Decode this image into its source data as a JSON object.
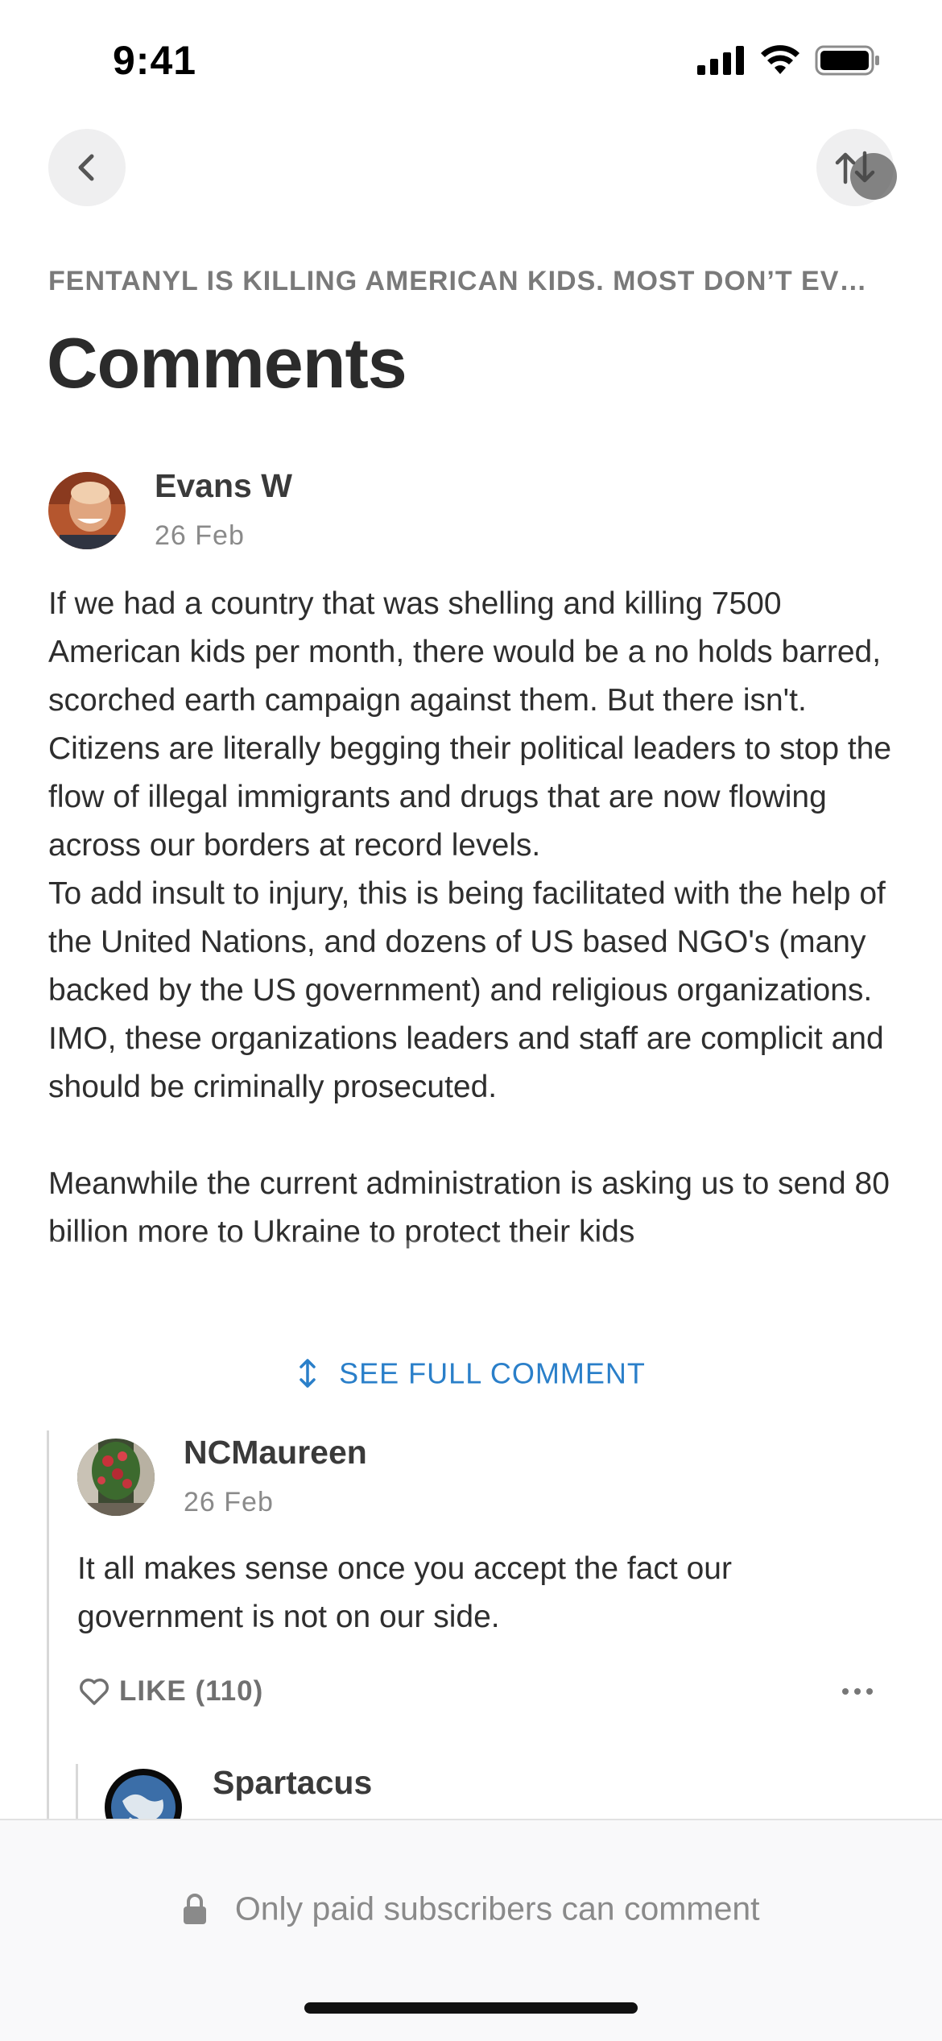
{
  "status_bar": {
    "time": "9:41"
  },
  "header": {
    "article_title": "FENTANYL IS KILLING AMERICAN KIDS. MOST DON’T EV…",
    "page_title": "Comments"
  },
  "comments": [
    {
      "author": "Evans W",
      "date": "26  Feb",
      "paragraphs": [
        "If we had a country that was shelling and killing 7500 American kids per month, there would be a no holds barred, scorched earth campaign against them.  But there isn't.",
        "Citizens are literally begging their political leaders to stop the flow of illegal immigrants and drugs that are now flowing across our borders at record levels.",
        "To add insult to injury, this is being facilitated with the help of the United Nations, and dozens of US based NGO's (many backed by the US government) and religious organizations.  IMO, these organizations leaders and staff are complicit and should be criminally prosecuted.",
        "",
        "Meanwhile the current administration is asking us to send 80 billion more to Ukraine to protect their kids"
      ],
      "see_full_label": "SEE FULL COMMENT"
    },
    {
      "author": "NCMaureen",
      "date": "26  Feb",
      "text": "It all makes sense once you accept the fact our government is not on our side.",
      "like_label": "LIKE (110)"
    },
    {
      "author": "Spartacus"
    }
  ],
  "footer": {
    "locked_message": "Only paid subscribers can comment"
  }
}
